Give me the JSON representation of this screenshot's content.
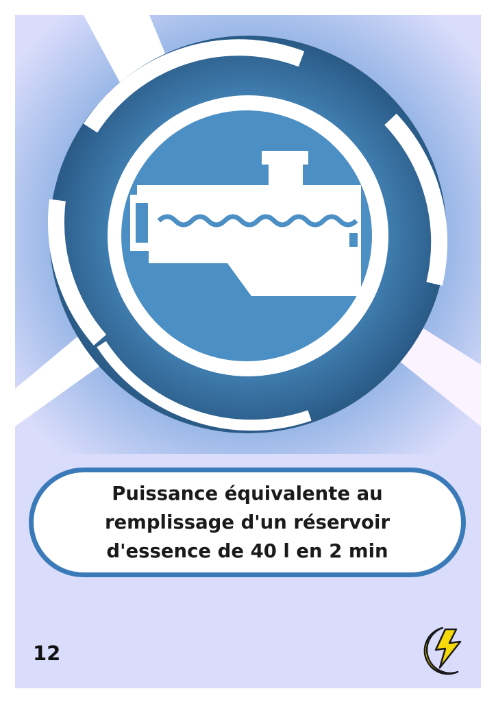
{
  "card": {
    "caption_lines": [
      "Puissance équivalente au",
      "remplissage d'un réservoir",
      "d'essence de 40 l en 2 min"
    ],
    "number": "12"
  },
  "colors": {
    "background": "#d9dcfb",
    "ring_dark": "#2a5a86",
    "ring_mid": "#3b7ab8",
    "center_blue": "#4b8fc4",
    "glow": "#7aa8dc",
    "caption_border": "#3b7ab8",
    "energy_yellow": "#f5d90a"
  },
  "icons": {
    "center": "engine-oil-icon",
    "corner": "energy-lightning-icon"
  }
}
